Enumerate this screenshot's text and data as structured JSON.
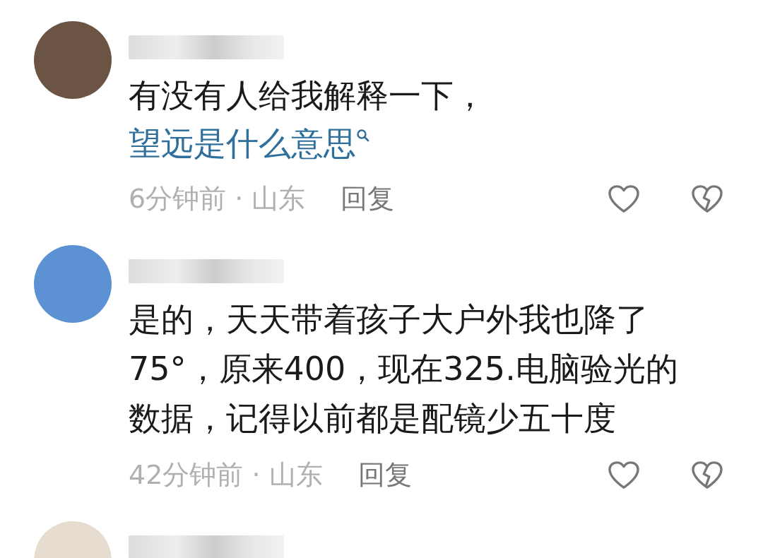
{
  "comments": [
    {
      "kind": "full",
      "color": "#6b5444",
      "text": "有没有人给我解释一下，",
      "link": "望远是什么意思",
      "meta": "6分钟前 · 山东",
      "reply": "回复"
    },
    {
      "kind": "full",
      "color": "#5c92d4",
      "text": "是的，天天带着孩子大户外我也降了75°，原来400，现在325.电脑验光的数据，记得以前都是配镜少五十度",
      "meta": "42分钟前 · 山东",
      "reply": "回复"
    },
    {
      "kind": "cut",
      "color": "#e6ddd0"
    }
  ]
}
